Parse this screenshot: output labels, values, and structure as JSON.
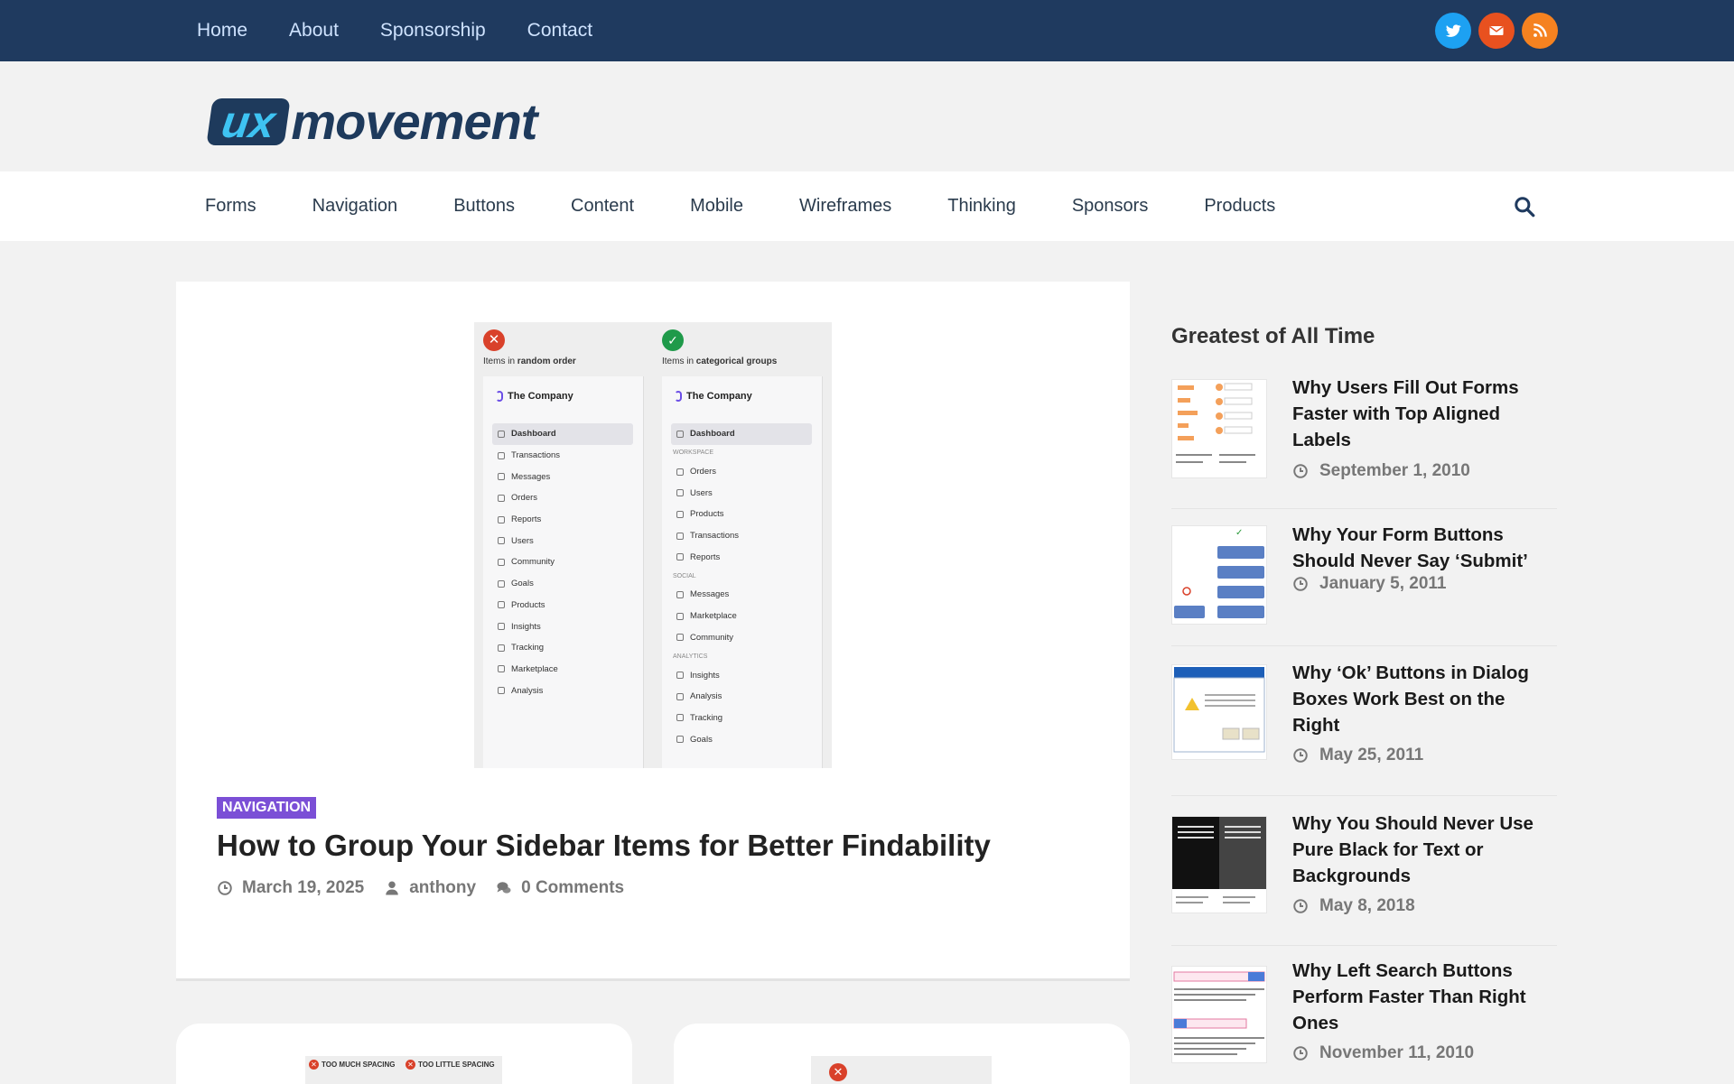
{
  "topnav": {
    "items": [
      "Home",
      "About",
      "Sponsorship",
      "Contact"
    ],
    "social": [
      "twitter-icon",
      "email-icon",
      "rss-icon"
    ]
  },
  "brand": {
    "logo_ux": "ux",
    "logo_rest": "movement"
  },
  "catnav": {
    "items": [
      "Forms",
      "Navigation",
      "Buttons",
      "Content",
      "Mobile",
      "Wireframes",
      "Thinking",
      "Sponsors",
      "Products"
    ]
  },
  "featured": {
    "image": {
      "left_caption_pre": "Items in ",
      "left_caption_bold": "random order",
      "right_caption_pre": "Items in ",
      "right_caption_bold": "categorical groups",
      "company": "The Company",
      "left_items": [
        "Dashboard",
        "Transactions",
        "Messages",
        "Orders",
        "Reports",
        "Users",
        "Community",
        "Goals",
        "Products",
        "Insights",
        "Tracking",
        "Marketplace",
        "Analysis"
      ],
      "right_items": [
        "Dashboard",
        "WORKSPACE",
        "Orders",
        "Users",
        "Products",
        "Transactions",
        "Reports",
        "SOCIAL",
        "Messages",
        "Marketplace",
        "Community",
        "ANALYTICS",
        "Insights",
        "Analysis",
        "Tracking",
        "Goals"
      ]
    },
    "category": "NAVIGATION",
    "title": "How to Group Your Sidebar Items for Better Findability",
    "date": "March 19, 2025",
    "author": "anthony",
    "comments": "0 Comments"
  },
  "bottom_cards": {
    "card1_labels": [
      "TOO MUCH SPACING",
      "TOO LITTLE SPACING"
    ]
  },
  "sidebar": {
    "heading": "Greatest of All Time",
    "posts": [
      {
        "title": "Why Users Fill Out Forms Faster with Top Aligned Labels",
        "date": "September 1, 2010"
      },
      {
        "title": "Why Your Form Buttons Should Never Say ‘Submit’",
        "date": "January 5, 2011"
      },
      {
        "title": "Why ‘Ok’ Buttons in Dialog Boxes Work Best on the Right",
        "date": "May 25, 2011"
      },
      {
        "title": "Why You Should Never Use Pure Black for Text or Backgrounds",
        "date": "May 8, 2018"
      },
      {
        "title": "Why Left Search Buttons Perform Faster Than Right Ones",
        "date": "November 11, 2010"
      }
    ]
  },
  "colors": {
    "topbar": "#1f3a5f",
    "tag": "#7b4fd6",
    "twitter": "#1da1f2",
    "email": "#e8511f",
    "rss": "#f58220"
  }
}
